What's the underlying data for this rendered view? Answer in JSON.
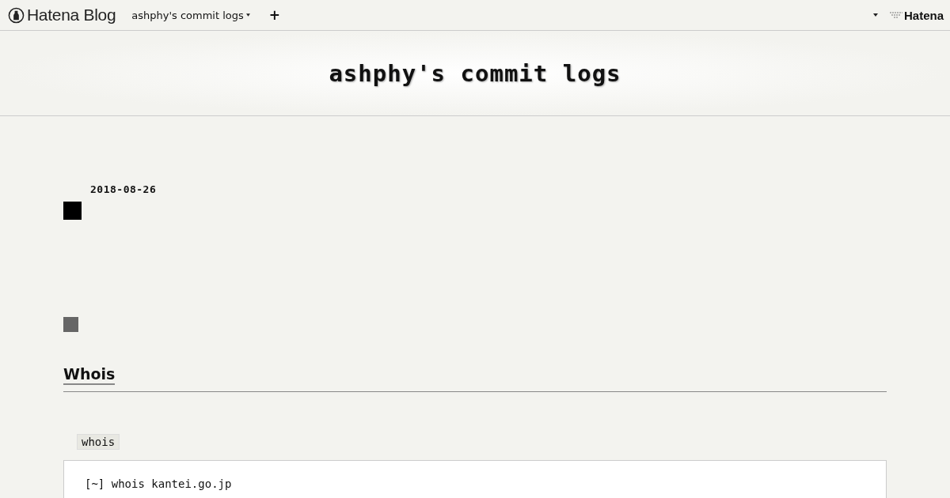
{
  "navbar": {
    "brand": "Hatena Blog",
    "blog_menu": "ashphy's commit logs",
    "add": "+",
    "right_brand": "Hatena"
  },
  "blog_title": "ashphy's commit logs",
  "entry": {
    "date": "2018-08-26",
    "heading": "Whois",
    "tag": "whois",
    "code_lines": [
      "[~] whois kantei.go.jp"
    ]
  }
}
